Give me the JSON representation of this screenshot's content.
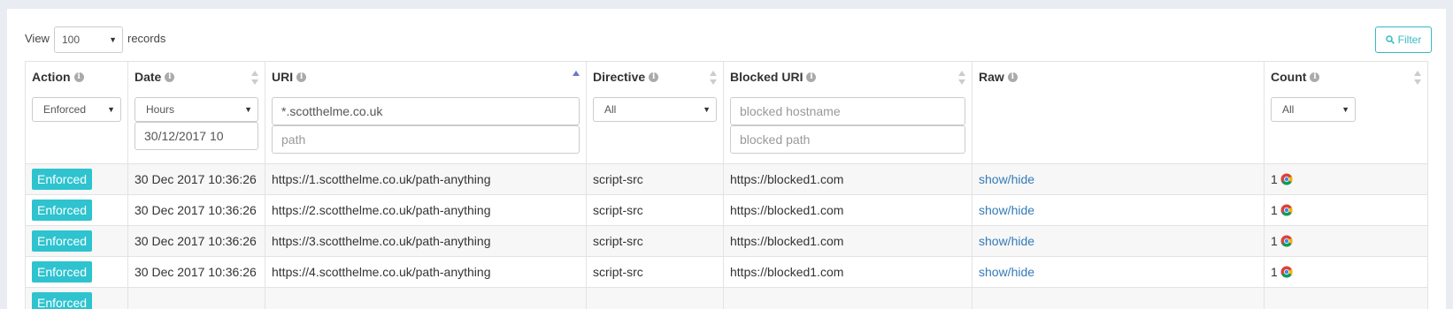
{
  "toolbar": {
    "view_label": "View",
    "view_value": "100",
    "records_label": "records",
    "filter_label": "Filter"
  },
  "columns": [
    {
      "title": "Action",
      "sortable": false
    },
    {
      "title": "Date",
      "sortable": true
    },
    {
      "title": "URI",
      "sortable": true,
      "sort": "asc"
    },
    {
      "title": "Directive",
      "sortable": true
    },
    {
      "title": "Blocked URI",
      "sortable": true
    },
    {
      "title": "Raw",
      "sortable": false
    },
    {
      "title": "Count",
      "sortable": true
    }
  ],
  "filters": {
    "action_select": "Enforced",
    "date_select": "Hours",
    "date_value": "30/12/2017 10",
    "uri_host_value": "*.scotthelme.co.uk",
    "uri_path_placeholder": "path",
    "directive_select": "All",
    "blocked_host_placeholder": "blocked hostname",
    "blocked_path_placeholder": "blocked path",
    "count_select": "All"
  },
  "rows": [
    {
      "action": "Enforced",
      "date": "30 Dec 2017 10:36:26",
      "uri": "https://1.scotthelme.co.uk/path-anything",
      "directive": "script-src",
      "blocked_uri": "https://blocked1.com",
      "raw": "show/hide",
      "count": "1",
      "browser": "chrome-icon"
    },
    {
      "action": "Enforced",
      "date": "30 Dec 2017 10:36:26",
      "uri": "https://2.scotthelme.co.uk/path-anything",
      "directive": "script-src",
      "blocked_uri": "https://blocked1.com",
      "raw": "show/hide",
      "count": "1",
      "browser": "chrome-icon"
    },
    {
      "action": "Enforced",
      "date": "30 Dec 2017 10:36:26",
      "uri": "https://3.scotthelme.co.uk/path-anything",
      "directive": "script-src",
      "blocked_uri": "https://blocked1.com",
      "raw": "show/hide",
      "count": "1",
      "browser": "chrome-icon"
    },
    {
      "action": "Enforced",
      "date": "30 Dec 2017 10:36:26",
      "uri": "https://4.scotthelme.co.uk/path-anything",
      "directive": "script-src",
      "blocked_uri": "https://blocked1.com",
      "raw": "show/hide",
      "count": "1",
      "browser": "chrome-icon"
    },
    {
      "action": "Enforced",
      "date": "",
      "uri": "",
      "directive": "",
      "blocked_uri": "",
      "raw": "",
      "count": "",
      "browser": ""
    }
  ],
  "colors": {
    "badge": "#2ec3cf",
    "link": "#337ab7",
    "filter_button": "#36b9c4",
    "sort_active": "#6a78c9",
    "page_background": "#e9ecf3"
  }
}
